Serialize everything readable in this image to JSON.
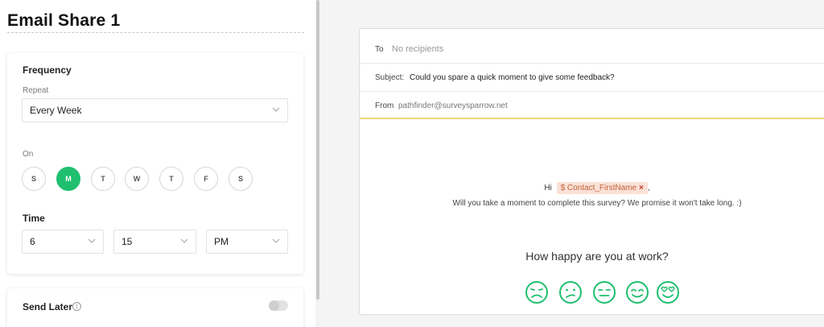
{
  "page_title": "Email Share 1",
  "frequency": {
    "title": "Frequency",
    "repeat_label": "Repeat",
    "repeat_value": "Every Week",
    "on_label": "On",
    "days": [
      {
        "label": "S",
        "selected": false
      },
      {
        "label": "M",
        "selected": true
      },
      {
        "label": "T",
        "selected": false
      },
      {
        "label": "W",
        "selected": false
      },
      {
        "label": "T",
        "selected": false
      },
      {
        "label": "F",
        "selected": false
      },
      {
        "label": "S",
        "selected": false
      }
    ],
    "time_title": "Time",
    "hour": "6",
    "minute": "15",
    "ampm": "PM"
  },
  "send_later": {
    "label": "Send Later",
    "info_icon": "i",
    "enabled": false
  },
  "email": {
    "to_label": "To",
    "to_value": "No recipients",
    "subject_label": "Subject:",
    "subject_value": "Could you spare a quick moment to give some feedback?",
    "from_label": "From",
    "from_value": "pathfinder@surveysparrow.net",
    "greeting": "Hi",
    "variable_symbol": "$",
    "variable_name": "Contact_FirstName",
    "variable_remove": "×",
    "greeting_suffix": ",",
    "message": "Will you take a moment to complete this survey? We promise it won't take long. :)",
    "question": "How happy are you at work?",
    "faces": [
      "very-sad-face-icon",
      "sad-face-icon",
      "neutral-face-icon",
      "happy-face-icon",
      "love-face-icon"
    ]
  },
  "colors": {
    "accent": "#1fbf6f",
    "variable_bg": "#fbe1d6",
    "divider": "#f2d27a"
  }
}
